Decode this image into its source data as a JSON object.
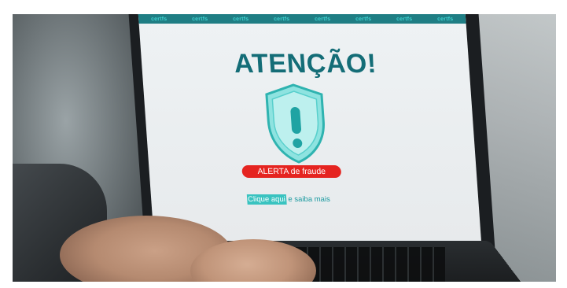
{
  "screen": {
    "brand_items": [
      "certfs",
      "certfs",
      "certfs",
      "certfs",
      "certfs",
      "certfs",
      "certfs",
      "certfs"
    ],
    "title": "ATENÇÃO!",
    "alert_label": "ALERTA de fraude",
    "link_highlight": "Clique aqui",
    "link_rest": " e saiba mais"
  },
  "colors": {
    "brand_teal": "#1f7e84",
    "title_teal": "#146d77",
    "alert_red": "#e52420",
    "highlight_teal": "#39c3c0"
  },
  "icons": {
    "shield": "shield-exclamation-icon"
  }
}
